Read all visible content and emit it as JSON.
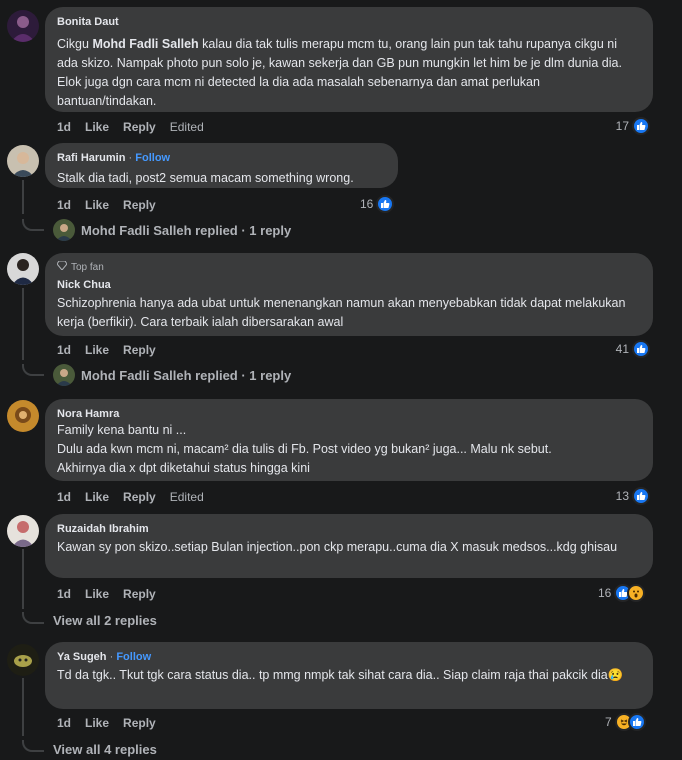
{
  "comments": [
    {
      "author": "Bonita Daut",
      "text_pre": "Cikgu ",
      "mention": "Mohd Fadli Salleh",
      "text_post": " kalau dia tak tulis merapu mcm tu, orang lain pun tak tahu rupanya cikgu ni ada skizo. Nampak photo pun solo je, kawan sekerja dan GB pun mungkin let him be je dlm dunia dia. Elok juga dgn cara mcm ni detected la dia ada masalah sebenarnya dan amat perlukan bantuan/tindakan.",
      "time": "1d",
      "like": "Like",
      "reply": "Reply",
      "edited": "Edited",
      "reactions": "17"
    },
    {
      "author": "Rafi Harumin",
      "follow": "Follow",
      "text": "Stalk dia tadi, post2 semua macam something wrong.",
      "time": "1d",
      "like": "Like",
      "reply": "Reply",
      "reactions": "16",
      "replied": "Mohd Fadli Salleh replied · 1 reply"
    },
    {
      "badge": "Top fan",
      "author": "Nick Chua",
      "text": "Schizophrenia hanya ada ubat untuk menenangkan namun akan menyebabkan tidak dapat melakukan kerja (berfikir). Cara terbaik ialah dibersarakan awal",
      "time": "1d",
      "like": "Like",
      "reply": "Reply",
      "reactions": "41",
      "replied": "Mohd Fadli Salleh replied · 1 reply"
    },
    {
      "author": "Nora Hamra",
      "line1": "Family kena bantu ni ...",
      "line2": "Dulu ada kwn mcm ni, macam² dia tulis di Fb. Post video yg bukan² juga... Malu nk sebut.",
      "line3": "Akhirnya dia x dpt diketahui status hingga kini",
      "time": "1d",
      "like": "Like",
      "reply": "Reply",
      "edited": "Edited",
      "reactions": "13"
    },
    {
      "author": "Ruzaidah Ibrahim",
      "text": "Kawan sy pon skizo..setiap Bulan injection..pon ckp merapu..cuma dia X masuk medsos...kdg ghisau",
      "time": "1d",
      "like": "Like",
      "reply": "Reply",
      "reactions": "16",
      "view_all": "View all 2 replies"
    },
    {
      "author": "Ya Sugeh",
      "follow": "Follow",
      "text": "Td da tgk.. Tkut tgk cara status dia.. tp mmg nmpk tak sihat cara dia.. Siap claim raja thai pakcik dia",
      "emoji": "😢",
      "time": "1d",
      "like": "Like",
      "reply": "Reply",
      "reactions": "7",
      "view_all": "View all 4 replies"
    }
  ],
  "colors": {
    "bg": "#18191a",
    "bubble": "#3a3b3c",
    "link": "#4599ff",
    "like": "#1877f2",
    "muted": "#b0b3b8"
  }
}
